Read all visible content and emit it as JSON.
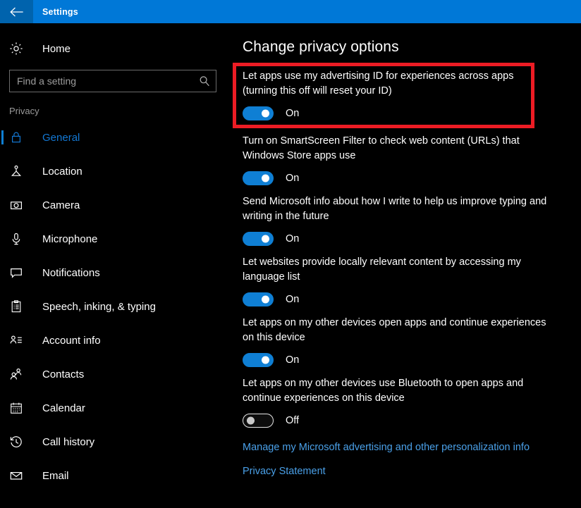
{
  "window": {
    "title": "Settings",
    "back_icon": "back-arrow-icon",
    "accent_color": "#0078d7",
    "back_button_color": "#0063ad",
    "background_color": "#000000"
  },
  "sidebar": {
    "home": {
      "label": "Home",
      "icon": "gear-icon"
    },
    "search": {
      "placeholder": "Find a setting",
      "value": "",
      "icon": "search-icon"
    },
    "group_header": "Privacy",
    "items": [
      {
        "label": "General",
        "icon": "lock-icon",
        "selected": true
      },
      {
        "label": "Location",
        "icon": "location-person-icon",
        "selected": false
      },
      {
        "label": "Camera",
        "icon": "camera-icon",
        "selected": false
      },
      {
        "label": "Microphone",
        "icon": "microphone-icon",
        "selected": false
      },
      {
        "label": "Notifications",
        "icon": "speech-bubble-icon",
        "selected": false
      },
      {
        "label": "Speech, inking, & typing",
        "icon": "clipboard-icon",
        "selected": false
      },
      {
        "label": "Account info",
        "icon": "account-info-icon",
        "selected": false
      },
      {
        "label": "Contacts",
        "icon": "contacts-people-icon",
        "selected": false
      },
      {
        "label": "Calendar",
        "icon": "calendar-icon",
        "selected": false
      },
      {
        "label": "Call history",
        "icon": "clock-history-icon",
        "selected": false
      },
      {
        "label": "Email",
        "icon": "envelope-icon",
        "selected": false
      }
    ],
    "selected_accent_color": "#0f7fd4"
  },
  "main": {
    "title": "Change privacy options",
    "settings": [
      {
        "label": "Let apps use my advertising ID for experiences across apps (turning this off will reset your ID)",
        "state": "On",
        "highlighted": true
      },
      {
        "label": "Turn on SmartScreen Filter to check web content (URLs) that Windows Store apps use",
        "state": "On",
        "highlighted": false
      },
      {
        "label": "Send Microsoft info about how I write to help us improve typing and writing in the future",
        "state": "On",
        "highlighted": false
      },
      {
        "label": "Let websites provide locally relevant content by accessing my language list",
        "state": "On",
        "highlighted": false
      },
      {
        "label": "Let apps on my other devices open apps and continue experiences on this device",
        "state": "On",
        "highlighted": false
      },
      {
        "label": "Let apps on my other devices use Bluetooth to open apps and continue experiences on this device",
        "state": "Off",
        "highlighted": false
      }
    ],
    "links": [
      {
        "label": "Manage my Microsoft advertising and other personalization info"
      },
      {
        "label": "Privacy Statement"
      }
    ],
    "highlight_color": "#ed1c24",
    "link_color": "#4aa0e8",
    "toggle_on_color": "#0f7fd4"
  }
}
